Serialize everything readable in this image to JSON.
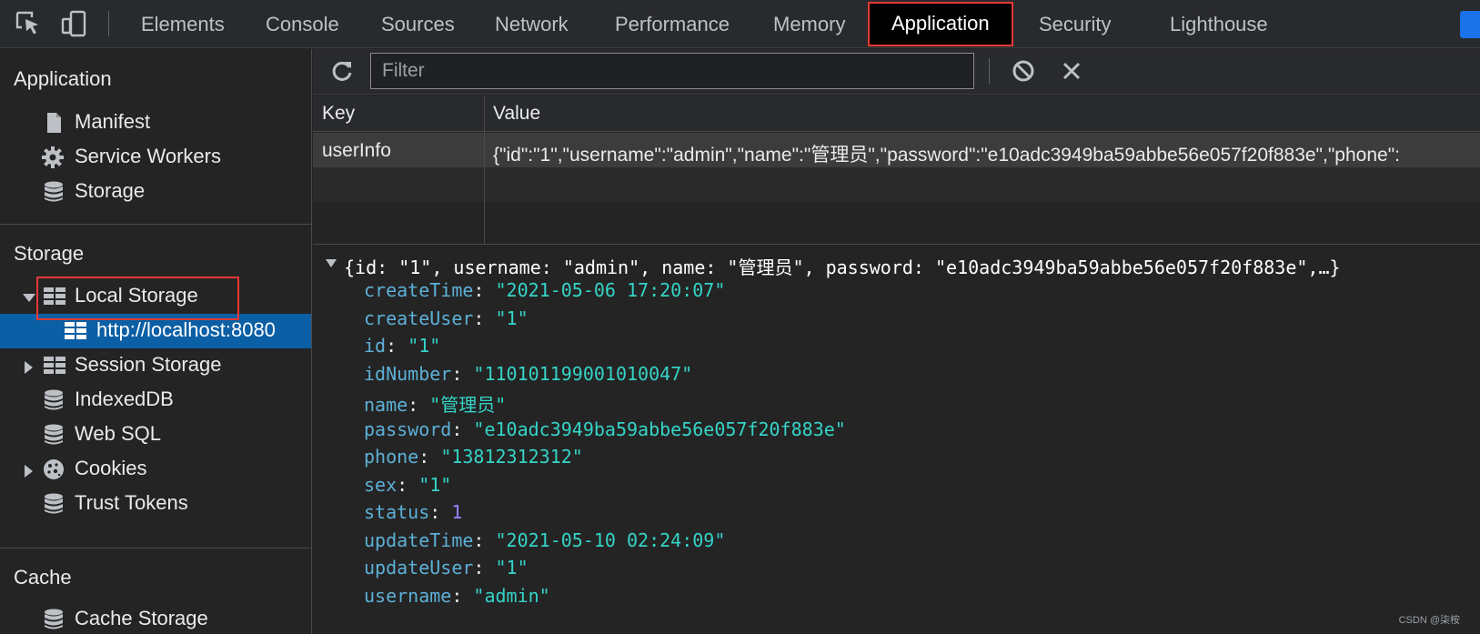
{
  "toolbar": {
    "tabs": [
      "Elements",
      "Console",
      "Sources",
      "Network",
      "Performance",
      "Memory",
      "Application",
      "Security",
      "Lighthouse"
    ],
    "active_tab": "Application",
    "icons": [
      "inspect-element-icon",
      "device-toolbar-icon"
    ]
  },
  "sidebar": {
    "application_title": "Application",
    "application_items": [
      "Manifest",
      "Service Workers",
      "Storage"
    ],
    "storage_title": "Storage",
    "storage_items": {
      "local_storage": "Local Storage",
      "local_storage_origin": "http://localhost:8080",
      "session_storage": "Session Storage",
      "indexeddb": "IndexedDB",
      "web_sql": "Web SQL",
      "cookies": "Cookies",
      "trust_tokens": "Trust Tokens"
    },
    "cache_title": "Cache",
    "cache_items": [
      "Cache Storage"
    ]
  },
  "filter": {
    "placeholder": "Filter",
    "value": ""
  },
  "grid": {
    "headers": {
      "key": "Key",
      "value": "Value"
    },
    "rows": [
      {
        "key": "userInfo",
        "value": "{\"id\":\"1\",\"username\":\"admin\",\"name\":\"管理员\",\"password\":\"e10adc3949ba59abbe56e057f20f883e\",\"phone\":"
      }
    ]
  },
  "preview": {
    "summary": "{id: \"1\", username: \"admin\", name: \"管理员\", password: \"e10adc3949ba59abbe56e057f20f883e\",…}",
    "properties": [
      {
        "key": "createTime",
        "value": "\"2021-05-06 17:20:07\"",
        "type": "string"
      },
      {
        "key": "createUser",
        "value": "\"1\"",
        "type": "string"
      },
      {
        "key": "id",
        "value": "\"1\"",
        "type": "string"
      },
      {
        "key": "idNumber",
        "value": "\"110101199001010047\"",
        "type": "string"
      },
      {
        "key": "name",
        "value": "\"管理员\"",
        "type": "string"
      },
      {
        "key": "password",
        "value": "\"e10adc3949ba59abbe56e057f20f883e\"",
        "type": "string"
      },
      {
        "key": "phone",
        "value": "\"13812312312\"",
        "type": "string"
      },
      {
        "key": "sex",
        "value": "\"1\"",
        "type": "string"
      },
      {
        "key": "status",
        "value": "1",
        "type": "number"
      },
      {
        "key": "updateTime",
        "value": "\"2021-05-10 02:24:09\"",
        "type": "string"
      },
      {
        "key": "updateUser",
        "value": "\"1\"",
        "type": "string"
      },
      {
        "key": "username",
        "value": "\"admin\"",
        "type": "string"
      }
    ]
  },
  "watermark": "CSDN @柒桉",
  "colors": {
    "accent_selection": "#0b5fa5",
    "highlight_box": "#e53935",
    "string_value": "#35d4c7",
    "property_key": "#5db0d7",
    "number_value": "#9980ff"
  }
}
